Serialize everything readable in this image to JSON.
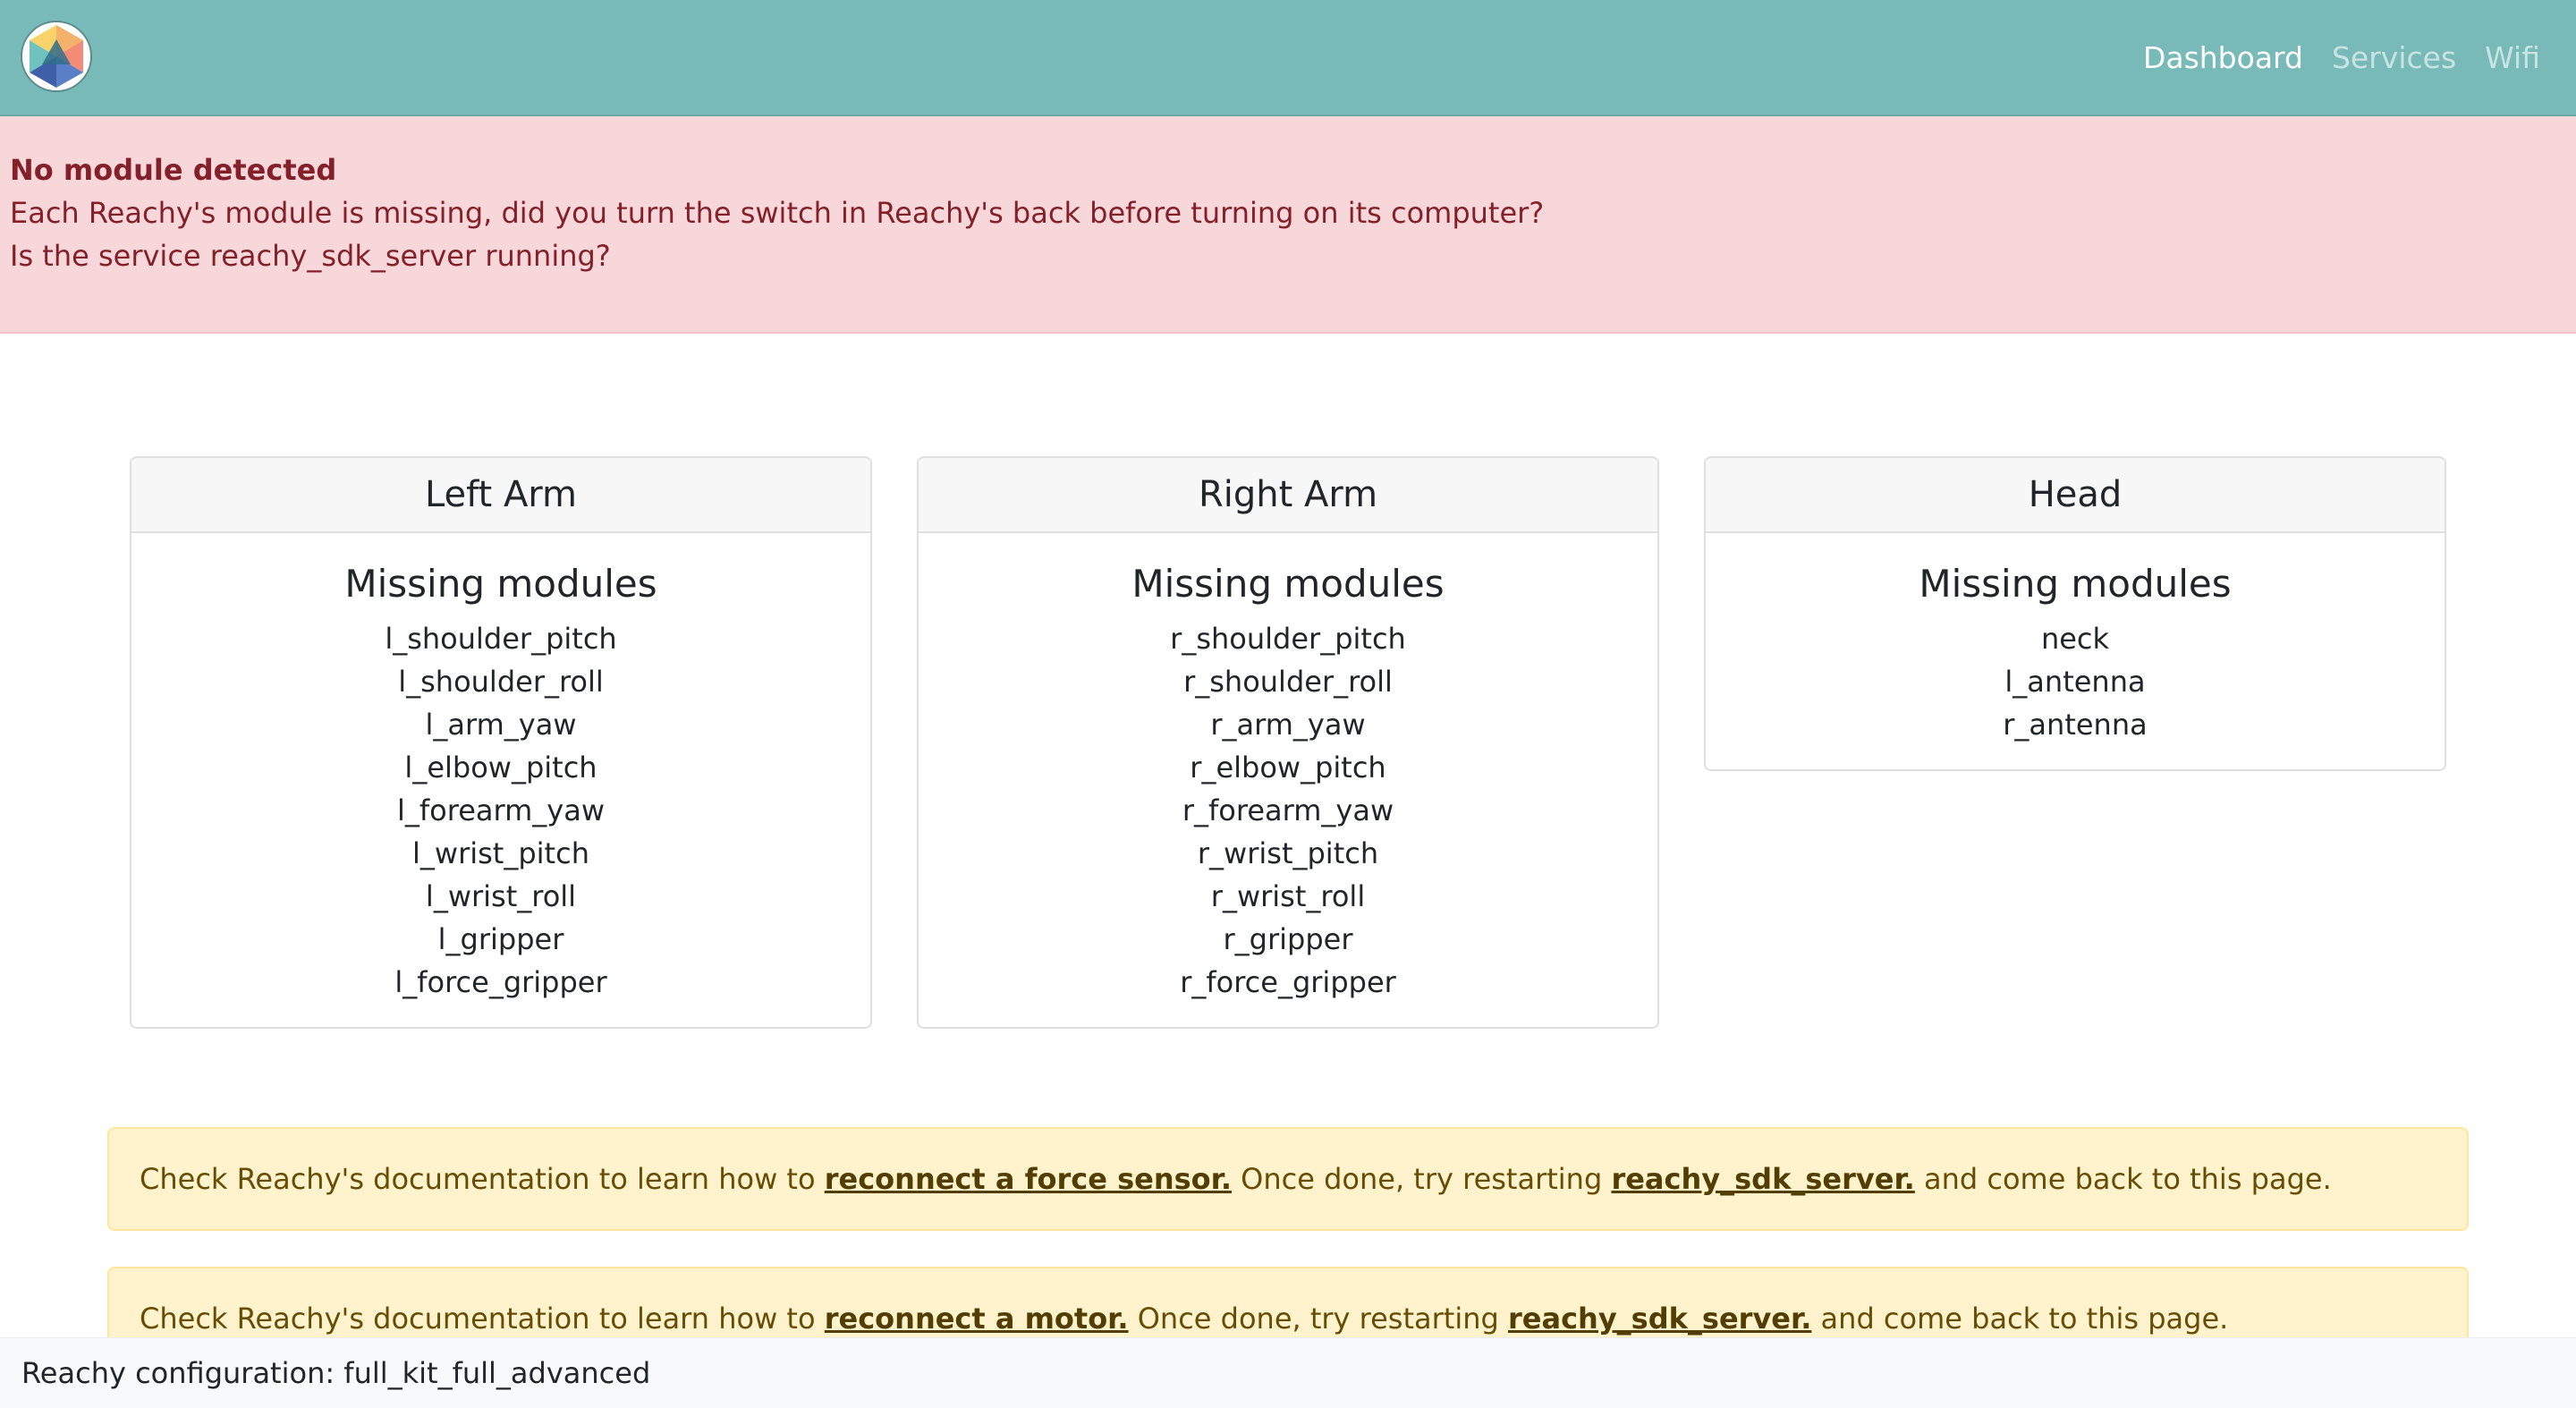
{
  "nav": {
    "logo_icon": "reachy-logo-icon",
    "links": [
      {
        "label": "Dashboard",
        "active": true
      },
      {
        "label": "Services",
        "active": false
      },
      {
        "label": "Wifi",
        "active": false
      }
    ]
  },
  "alert": {
    "title": "No module detected",
    "line1": "Each Reachy's module is missing, did you turn the switch in Reachy's back before turning on its computer?",
    "line2": "Is the service reachy_sdk_server running?"
  },
  "cards": [
    {
      "header": "Left Arm",
      "title": "Missing modules",
      "modules": [
        "l_shoulder_pitch",
        "l_shoulder_roll",
        "l_arm_yaw",
        "l_elbow_pitch",
        "l_forearm_yaw",
        "l_wrist_pitch",
        "l_wrist_roll",
        "l_gripper",
        "l_force_gripper"
      ]
    },
    {
      "header": "Right Arm",
      "title": "Missing modules",
      "modules": [
        "r_shoulder_pitch",
        "r_shoulder_roll",
        "r_arm_yaw",
        "r_elbow_pitch",
        "r_forearm_yaw",
        "r_wrist_pitch",
        "r_wrist_roll",
        "r_gripper",
        "r_force_gripper"
      ]
    },
    {
      "header": "Head",
      "title": "Missing modules",
      "modules": [
        "neck",
        "l_antenna",
        "r_antenna"
      ]
    }
  ],
  "warnings": [
    {
      "prefix": "Check Reachy's documentation to learn how to",
      "link1": "reconnect a force sensor.",
      "middle": "Once done, try restarting",
      "link2": "reachy_sdk_server.",
      "suffix": "and come back to this page."
    },
    {
      "prefix": "Check Reachy's documentation to learn how to",
      "link1": "reconnect a motor.",
      "middle": "Once done, try restarting",
      "link2": "reachy_sdk_server.",
      "suffix": "and come back to this page."
    }
  ],
  "footer": {
    "text": "Reachy configuration: full_kit_full_advanced"
  },
  "colors": {
    "navbar": "#78bab7",
    "danger_bg": "#f8d7da",
    "danger_text": "#842029",
    "warning_bg": "#fff3cd",
    "warning_text": "#664d03"
  }
}
